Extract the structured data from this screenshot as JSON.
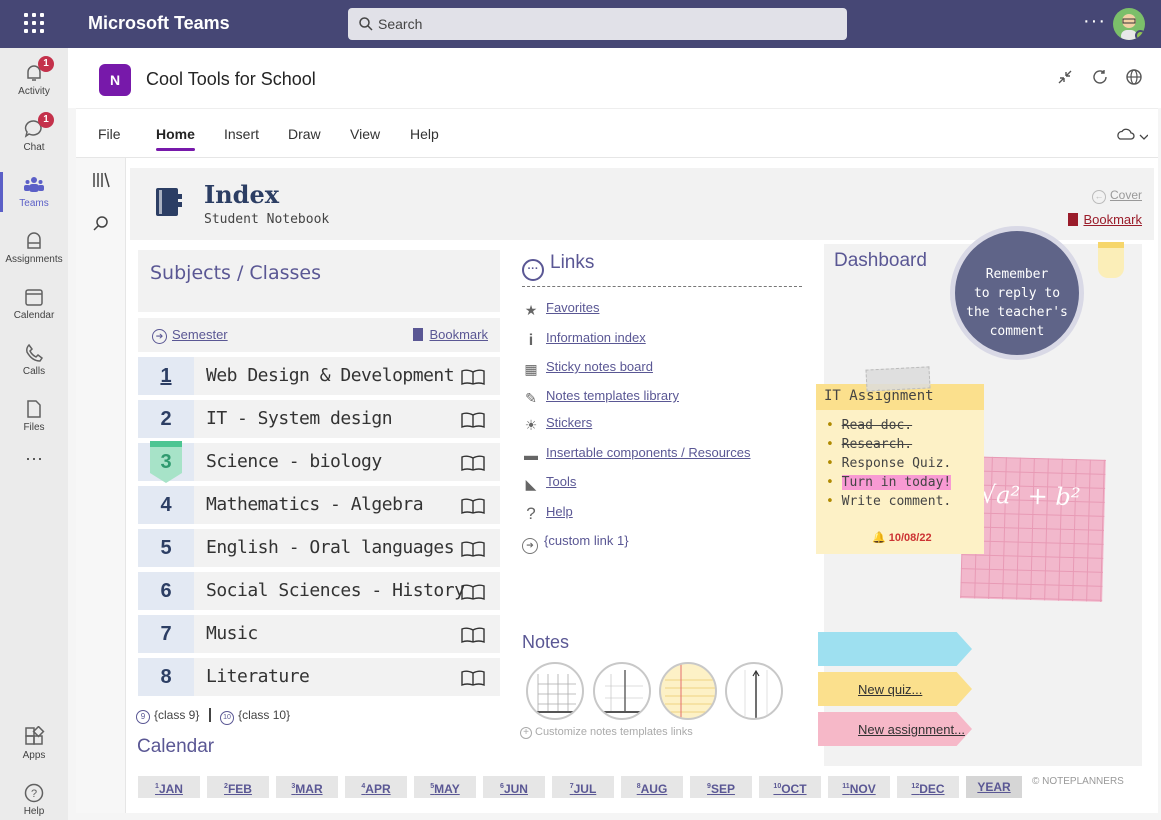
{
  "app": {
    "title": "Microsoft Teams",
    "search_placeholder": "Search",
    "more": "···"
  },
  "rail": [
    {
      "label": "Activity",
      "badge": "1"
    },
    {
      "label": "Chat",
      "badge": "1"
    },
    {
      "label": "Teams"
    },
    {
      "label": "Assignments"
    },
    {
      "label": "Calendar"
    },
    {
      "label": "Calls"
    },
    {
      "label": "Files"
    },
    {
      "label": "···"
    },
    {
      "label": "Apps"
    },
    {
      "label": "Help"
    }
  ],
  "notebook": {
    "title": "Cool Tools for School",
    "logo": "N"
  },
  "ribbon": {
    "tabs": [
      "File",
      "Home",
      "Insert",
      "Draw",
      "View",
      "Help"
    ],
    "active": "Home"
  },
  "index": {
    "title": "Index",
    "subtitle": "Student Notebook",
    "cover": "Cover",
    "bookmark": "Bookmark"
  },
  "subjects": {
    "title": "Subjects / Classes",
    "semester": "Semester",
    "bookmark": "Bookmark",
    "rows": [
      {
        "num": "1",
        "label": "Web Design & Development"
      },
      {
        "num": "2",
        "label": "IT - System design"
      },
      {
        "num": "3",
        "label": "Science - biology"
      },
      {
        "num": "4",
        "label": "Mathematics - Algebra"
      },
      {
        "num": "5",
        "label": "English - Oral languages"
      },
      {
        "num": "6",
        "label": "Social Sciences - History"
      },
      {
        "num": "7",
        "label": "Music"
      },
      {
        "num": "8",
        "label": "Literature"
      }
    ],
    "extra9": "{class 9}",
    "extra10": "{class 10}",
    "extra9_num": "9",
    "extra10_num": "10"
  },
  "calendar": {
    "title": "Calendar",
    "months": [
      {
        "n": "1",
        "m": "JAN"
      },
      {
        "n": "2",
        "m": "FEB"
      },
      {
        "n": "3",
        "m": "MAR"
      },
      {
        "n": "4",
        "m": "APR"
      },
      {
        "n": "5",
        "m": "MAY"
      },
      {
        "n": "6",
        "m": "JUN"
      },
      {
        "n": "7",
        "m": "JUL"
      },
      {
        "n": "8",
        "m": "AUG"
      },
      {
        "n": "9",
        "m": "SEP"
      },
      {
        "n": "10",
        "m": "OCT"
      },
      {
        "n": "11",
        "m": "NOV"
      },
      {
        "n": "12",
        "m": "DEC"
      }
    ],
    "year": "YEAR",
    "copyright": "© NOTEPLANNERS"
  },
  "links": {
    "title": "Links",
    "items": [
      {
        "icon": "star-icon",
        "glyph": "★",
        "label": "Favorites"
      },
      {
        "icon": "info-icon",
        "glyph": "i",
        "label": "Information index"
      },
      {
        "icon": "grid-icon",
        "glyph": "▦",
        "label": "Sticky notes board"
      },
      {
        "icon": "pencil-icon",
        "glyph": "✎",
        "label": "Notes templates library"
      },
      {
        "icon": "sun-icon",
        "glyph": "☀",
        "label": "Stickers"
      },
      {
        "icon": "folder-icon",
        "glyph": "▬",
        "label": "Insertable components / Resources"
      },
      {
        "icon": "ruler-icon",
        "glyph": "◣",
        "label": "Tools"
      },
      {
        "icon": "question-icon",
        "glyph": "?",
        "label": "Help"
      },
      {
        "icon": "arrow-circle-icon",
        "glyph": "➔",
        "label": "{custom link 1}"
      }
    ]
  },
  "notes": {
    "title": "Notes",
    "customize": "Customize notes templates links"
  },
  "dashboard": {
    "title": "Dashboard",
    "reminder": [
      "Remember",
      "to reply to",
      "the teacher's",
      "comment"
    ],
    "sticky_title": "IT Assignment",
    "tasks": [
      {
        "text": "Read doc.",
        "done": true
      },
      {
        "text": "Research.",
        "done": true
      },
      {
        "text": "Response Quiz.",
        "done": false
      },
      {
        "text": "Turn in today!",
        "done": false,
        "highlight": true
      },
      {
        "text": "Write comment.",
        "done": false
      }
    ],
    "date": "10/08/22",
    "equation": "√a² + b²",
    "flags": [
      {
        "label": "",
        "color": "#9ee0f0"
      },
      {
        "label": "New quiz...",
        "color": "#fbe08d"
      },
      {
        "label": "New assignment...",
        "color": "#f6b8c8"
      }
    ]
  }
}
